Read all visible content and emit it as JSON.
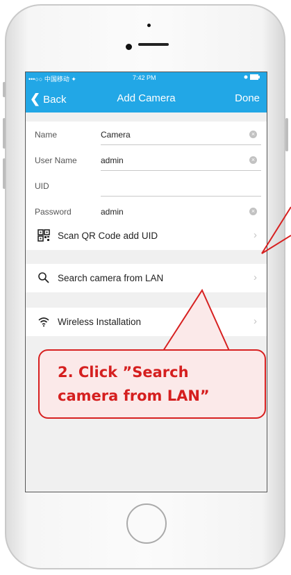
{
  "status_bar": {
    "carrier": "•••○○ 中国移动 ✦",
    "time": "7:42 PM"
  },
  "nav": {
    "back_label": "Back",
    "title": "Add Camera",
    "done_label": "Done"
  },
  "form": {
    "fields": [
      {
        "label": "Name",
        "value": "Camera"
      },
      {
        "label": "User Name",
        "value": "admin"
      },
      {
        "label": "UID",
        "value": ""
      },
      {
        "label": "Password",
        "value": "admin"
      }
    ]
  },
  "menu": {
    "items": [
      {
        "label": "Scan QR Code add UID",
        "icon": "qr-code-icon"
      },
      {
        "label": "Search camera from LAN",
        "icon": "search-icon"
      },
      {
        "label": "Wireless Installation",
        "icon": "wifi-icon"
      }
    ]
  },
  "annotation": {
    "line1": "2. Click  ”Search",
    "line2": "camera from LAN”"
  },
  "colors": {
    "accent": "#22a7e6",
    "annotation_red": "#d72020"
  }
}
